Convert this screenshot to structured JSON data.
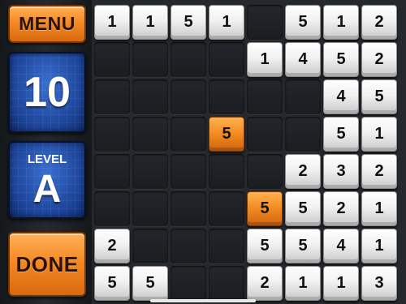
{
  "sidebar": {
    "menu_label": "MENU",
    "moves_value": "10",
    "level_label": "LEVEL",
    "level_value": "A",
    "done_label": "DONE"
  },
  "board": {
    "cols": 8,
    "rows": 8,
    "tiles": [
      {
        "row": 0,
        "col": 0,
        "value": "1",
        "color": "white"
      },
      {
        "row": 0,
        "col": 1,
        "value": "1",
        "color": "white"
      },
      {
        "row": 0,
        "col": 2,
        "value": "5",
        "color": "white"
      },
      {
        "row": 0,
        "col": 3,
        "value": "1",
        "color": "white"
      },
      {
        "row": 0,
        "col": 5,
        "value": "5",
        "color": "white"
      },
      {
        "row": 0,
        "col": 6,
        "value": "1",
        "color": "white"
      },
      {
        "row": 0,
        "col": 7,
        "value": "2",
        "color": "white"
      },
      {
        "row": 1,
        "col": 4,
        "value": "1",
        "color": "white"
      },
      {
        "row": 1,
        "col": 5,
        "value": "4",
        "color": "white"
      },
      {
        "row": 1,
        "col": 6,
        "value": "5",
        "color": "white"
      },
      {
        "row": 1,
        "col": 7,
        "value": "2",
        "color": "white"
      },
      {
        "row": 2,
        "col": 6,
        "value": "4",
        "color": "white"
      },
      {
        "row": 2,
        "col": 7,
        "value": "5",
        "color": "white"
      },
      {
        "row": 3,
        "col": 3,
        "value": "5",
        "color": "orange"
      },
      {
        "row": 3,
        "col": 6,
        "value": "5",
        "color": "white"
      },
      {
        "row": 3,
        "col": 7,
        "value": "1",
        "color": "white"
      },
      {
        "row": 4,
        "col": 5,
        "value": "2",
        "color": "white"
      },
      {
        "row": 4,
        "col": 6,
        "value": "3",
        "color": "white"
      },
      {
        "row": 4,
        "col": 7,
        "value": "2",
        "color": "white"
      },
      {
        "row": 5,
        "col": 4,
        "value": "5",
        "color": "orange"
      },
      {
        "row": 5,
        "col": 5,
        "value": "5",
        "color": "white"
      },
      {
        "row": 5,
        "col": 6,
        "value": "2",
        "color": "white"
      },
      {
        "row": 5,
        "col": 7,
        "value": "1",
        "color": "white"
      },
      {
        "row": 6,
        "col": 0,
        "value": "2",
        "color": "white"
      },
      {
        "row": 6,
        "col": 4,
        "value": "5",
        "color": "white"
      },
      {
        "row": 6,
        "col": 5,
        "value": "5",
        "color": "white"
      },
      {
        "row": 6,
        "col": 6,
        "value": "4",
        "color": "white"
      },
      {
        "row": 6,
        "col": 7,
        "value": "1",
        "color": "white"
      },
      {
        "row": 7,
        "col": 0,
        "value": "5",
        "color": "white"
      },
      {
        "row": 7,
        "col": 1,
        "value": "5",
        "color": "white"
      },
      {
        "row": 7,
        "col": 4,
        "value": "2",
        "color": "white"
      },
      {
        "row": 7,
        "col": 5,
        "value": "1",
        "color": "white"
      },
      {
        "row": 7,
        "col": 6,
        "value": "1",
        "color": "white"
      },
      {
        "row": 7,
        "col": 7,
        "value": "3",
        "color": "white"
      }
    ]
  },
  "colors": {
    "tile_white": "#f1f1f1",
    "tile_orange": "#f28a20",
    "panel_blue": "#1d4aa2",
    "button_orange": "#f48a25"
  }
}
